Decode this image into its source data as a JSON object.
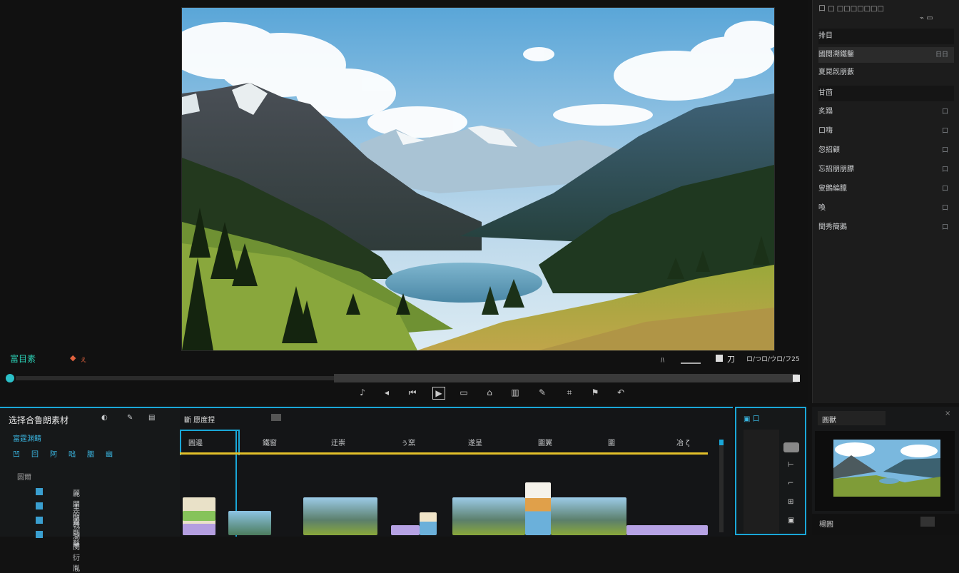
{
  "viewer": {
    "status_label": "富目素",
    "marker_label": "ぇ",
    "right_label": "ロ/つロ/ウロ/フ25",
    "glyph_a": "ﾊ",
    "glyph_b": "刀"
  },
  "right_panel": {
    "top_caption": "口 □ □□□□□□□",
    "section1_title": "排目",
    "selected_label": "國閱溯鐵鑿",
    "selected_value": "日日",
    "row2_label": "夏昆旣朋藪",
    "section2_title": "甘茴",
    "items": [
      {
        "label": "炙蹋",
        "value": "口"
      },
      {
        "label": "口嗨",
        "value": "口"
      },
      {
        "label": "忽招顧",
        "value": "口"
      },
      {
        "label": "忘招朋朋膘",
        "value": "口"
      },
      {
        "label": "叟鵝編臘",
        "value": "口"
      },
      {
        "label": "喚",
        "value": "口"
      },
      {
        "label": "閏秀簡鵝",
        "value": "口"
      }
    ]
  },
  "project_panel": {
    "title": "选择合鲁朗素材",
    "subtitle": "富霆渊鲭",
    "icons_row": [
      "凹",
      "回",
      "阿",
      "咄",
      "胭",
      "幽"
    ],
    "section_label": "圆爾",
    "rows": [
      "麗朋的戟",
      "圭朋",
      "霜剴鑿",
      "湖閔衍胤"
    ]
  },
  "timeline": {
    "tab_label": "斷 愿度捏",
    "ruler": [
      "圓邊",
      "鐵窗",
      "迂崇",
      "ぅ窯",
      "遂呈",
      "圍翼",
      "圍",
      "冶 ζ"
    ]
  },
  "preview_panel": {
    "title": "圓獸",
    "footer": "楊圓"
  },
  "colors": {
    "accent": "#1aa7d8",
    "timeline_yellow": "#e3c02a",
    "bg": "#121212"
  }
}
